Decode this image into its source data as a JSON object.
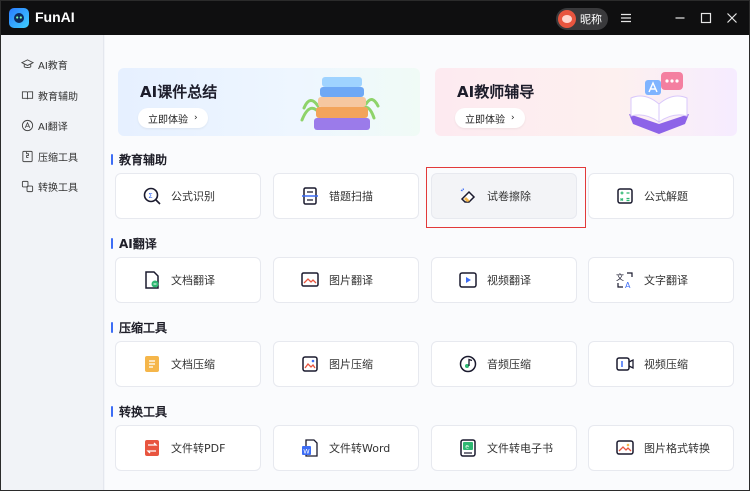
{
  "app": {
    "title": "FunAI",
    "username": "昵称"
  },
  "sidebar": {
    "items": [
      {
        "label": "AI教育",
        "icon": "graduation-cap-icon"
      },
      {
        "label": "教育辅助",
        "icon": "book-icon"
      },
      {
        "label": "AI翻译",
        "icon": "translate-icon"
      },
      {
        "label": "压缩工具",
        "icon": "compress-icon"
      },
      {
        "label": "转换工具",
        "icon": "convert-icon"
      }
    ]
  },
  "banners": [
    {
      "title": "AI课件总结",
      "button": "立即体验",
      "arrow": "›"
    },
    {
      "title": "AI教师辅导",
      "button": "立即体验",
      "arrow": "›"
    }
  ],
  "sections": [
    {
      "title": "教育辅助",
      "cards": [
        {
          "label": "公式识别",
          "icon": "formula-recognition-icon"
        },
        {
          "label": "错题扫描",
          "icon": "scan-icon"
        },
        {
          "label": "试卷擦除",
          "icon": "eraser-icon"
        },
        {
          "label": "公式解题",
          "icon": "calculator-icon"
        }
      ]
    },
    {
      "title": "AI翻译",
      "cards": [
        {
          "label": "文档翻译",
          "icon": "document-translate-icon"
        },
        {
          "label": "图片翻译",
          "icon": "image-translate-icon"
        },
        {
          "label": "视频翻译",
          "icon": "video-translate-icon"
        },
        {
          "label": "文字翻译",
          "icon": "text-translate-icon"
        }
      ]
    },
    {
      "title": "压缩工具",
      "cards": [
        {
          "label": "文档压缩",
          "icon": "document-compress-icon"
        },
        {
          "label": "图片压缩",
          "icon": "image-compress-icon"
        },
        {
          "label": "音频压缩",
          "icon": "audio-compress-icon"
        },
        {
          "label": "视频压缩",
          "icon": "video-compress-icon"
        }
      ]
    },
    {
      "title": "转换工具",
      "cards": [
        {
          "label": "文件转PDF",
          "icon": "pdf-convert-icon"
        },
        {
          "label": "文件转Word",
          "icon": "word-convert-icon"
        },
        {
          "label": "文件转电子书",
          "icon": "ebook-convert-icon"
        },
        {
          "label": "图片格式转换",
          "icon": "image-format-icon"
        }
      ]
    }
  ],
  "colors": {
    "accent": "#3d6df5",
    "highlight": "#e23a3a",
    "titlebar": "#0f0f10"
  }
}
